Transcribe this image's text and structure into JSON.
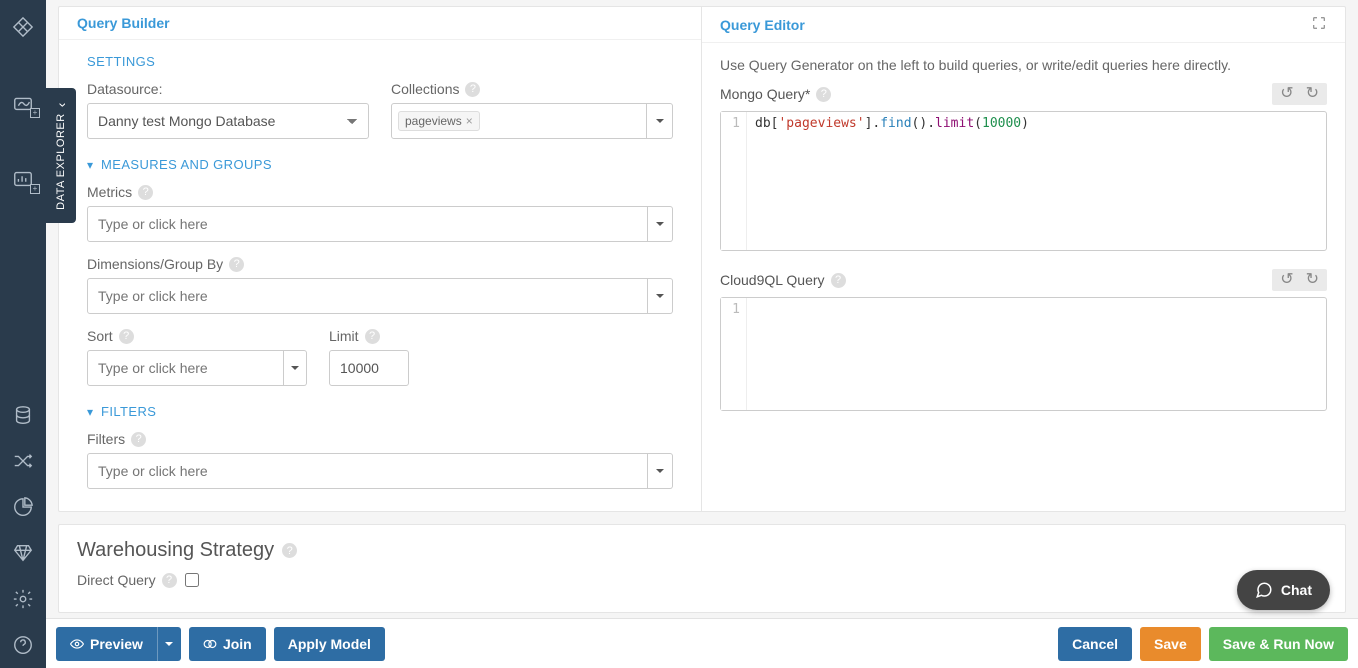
{
  "sidetab": {
    "label": "DATA EXPLORER"
  },
  "query_builder": {
    "title": "Query Builder",
    "sections": {
      "settings": "SETTINGS",
      "measures": "MEASURES AND GROUPS",
      "filters": "FILTERS"
    },
    "labels": {
      "datasource": "Datasource:",
      "collections": "Collections",
      "metrics": "Metrics",
      "dimensions": "Dimensions/Group By",
      "sort": "Sort",
      "limit": "Limit",
      "filters": "Filters"
    },
    "placeholders": {
      "metrics": "Type or click here",
      "dimensions": "Type or click here",
      "sort": "Type or click here",
      "filters": "Type or click here"
    },
    "values": {
      "datasource": "Danny test Mongo Database",
      "collections_tokens": [
        "pageviews"
      ],
      "limit": "10000"
    }
  },
  "query_editor": {
    "title": "Query Editor",
    "hint": "Use Query Generator on the left to build queries, or write/edit queries here directly.",
    "mongo_label": "Mongo Query*",
    "cloud9_label": "Cloud9QL Query",
    "mongo_code": {
      "line_no": "1",
      "prefix": "db[",
      "key": "'pageviews'",
      "after_key": "].",
      "fn1": "find",
      "paren1": "().",
      "fn2": "limit",
      "paren2_open": "(",
      "num": "10000",
      "paren2_close": ")"
    },
    "cloud9_code": {
      "line_no": "1"
    }
  },
  "warehousing": {
    "title": "Warehousing Strategy",
    "direct_query_label": "Direct Query"
  },
  "footer": {
    "preview": "Preview",
    "join": "Join",
    "apply_model": "Apply Model",
    "cancel": "Cancel",
    "save": "Save",
    "save_run": "Save & Run Now"
  },
  "chat": {
    "label": "Chat"
  }
}
